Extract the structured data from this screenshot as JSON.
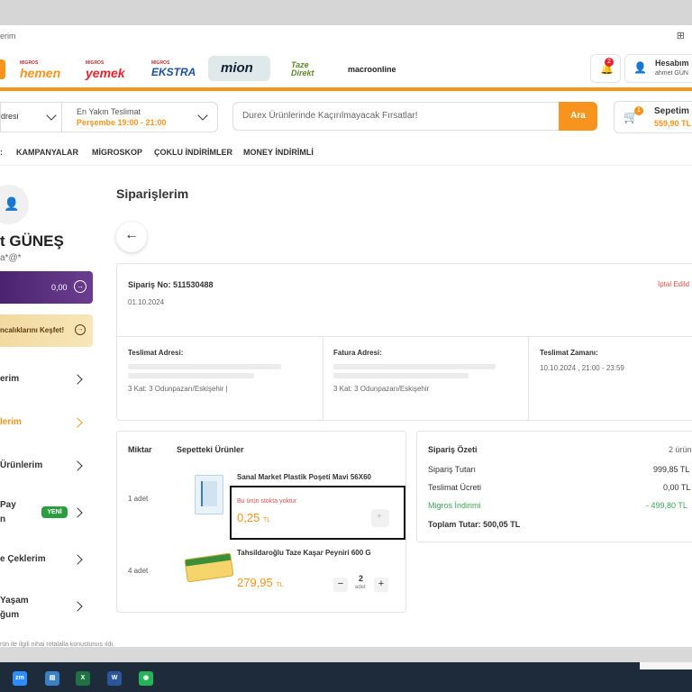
{
  "browser": {
    "url_partial": "erim"
  },
  "brands": [
    {
      "name": "hemen",
      "tag": "MIGROS"
    },
    {
      "name": "yemek",
      "tag": "MIGROS"
    },
    {
      "name": "EKSTRA",
      "tag": "MIGROS"
    },
    {
      "name": "mion",
      "tag": ""
    },
    {
      "name": "Taze Direkt",
      "tag": ""
    },
    {
      "name": "macroonline",
      "tag": ""
    }
  ],
  "header": {
    "notif_count": "2",
    "account_title": "Hesabım",
    "account_user": "ahmet GÜN"
  },
  "search_row": {
    "address_label": "dresi",
    "delivery_title": "En Yakın Teslimat",
    "delivery_time": "Perşembe 19:00 - 21:00",
    "search_placeholder": "Durex Ürünlerinde Kaçırılmayacak Fırsatlar!",
    "search_button": "Ara",
    "cart_label": "Sepetim",
    "cart_total": "559,90 TL",
    "cart_count": "1"
  },
  "nav": [
    "KAMPANYALAR",
    "MİGROSKOP",
    "ÇOKLU İNDİRİMLER",
    "MONEY İNDİRİMLİ"
  ],
  "sidebar": {
    "user_name": "t GÜNEŞ",
    "user_email": "a*@*",
    "money_value": "0,00",
    "explore_label": "ncalıklarını Keşfet!",
    "items": [
      {
        "label": "erim",
        "active": false
      },
      {
        "label": "lerim",
        "active": true
      },
      {
        "label": "Ürünlerim",
        "active": false
      },
      {
        "label": "Pay",
        "label2": "n",
        "badge": "YENİ",
        "active": false
      },
      {
        "label": "e Çeklerim",
        "active": false
      },
      {
        "label": "Yaşam",
        "label2": "ğum",
        "active": false
      }
    ]
  },
  "page": {
    "title": "Siparişlerim",
    "order_no_label": "Sipariş No: 511530488",
    "order_date": "01.10.2024",
    "order_status": "İptal Edild",
    "delivery_address_label": "Teslimat Adresi:",
    "delivery_address_text": "3 Kat: 3 Odunpazarı/Eskişehir |",
    "invoice_address_label": "Fatura Adresi:",
    "invoice_address_text": "3 Kat: 3 Odunpazarı/Eskişehir",
    "delivery_time_label": "Teslimat Zamanı:",
    "delivery_time_value": "10.10.2024 , 21:00 - 23:59"
  },
  "products_panel": {
    "col_qty": "Miktar",
    "col_items": "Sepetteki Ürünler",
    "items": [
      {
        "qty": "1 adet",
        "name": "Sanal Market Plastik Poşeti Mavi 56X60",
        "stock_note": "Bu ürün stokta yoktur",
        "price": "0,25",
        "currency": "TL"
      },
      {
        "qty": "4 adet",
        "name": "Tahsildaroğlu Taze Kaşar Peyniri 600 G",
        "price": "279,95",
        "currency": "TL",
        "stepper_value": "2",
        "stepper_unit": "adet"
      }
    ]
  },
  "summary": {
    "title": "Sipariş Özeti",
    "count": "2 ürün",
    "rows": [
      {
        "label": "Sipariş Tutarı",
        "value": "999,85 TL"
      },
      {
        "label": "Teslimat Ücreti",
        "value": "0,00 TL"
      },
      {
        "label": "Migros İndirimi",
        "value": "- 499,80 TL"
      }
    ],
    "total_label": "Toplam Tutar: 500,05 TL"
  },
  "footer_note": "rün ile ilgili nihai rotalalla konusturuıs ıldı.",
  "taskbar": [
    "zm",
    "explorer",
    "X",
    "W",
    "app"
  ],
  "colors": {
    "accent": "#f7941d",
    "discount": "#3aa655",
    "money": "#5a2d82",
    "status_red": "#d9534f"
  }
}
